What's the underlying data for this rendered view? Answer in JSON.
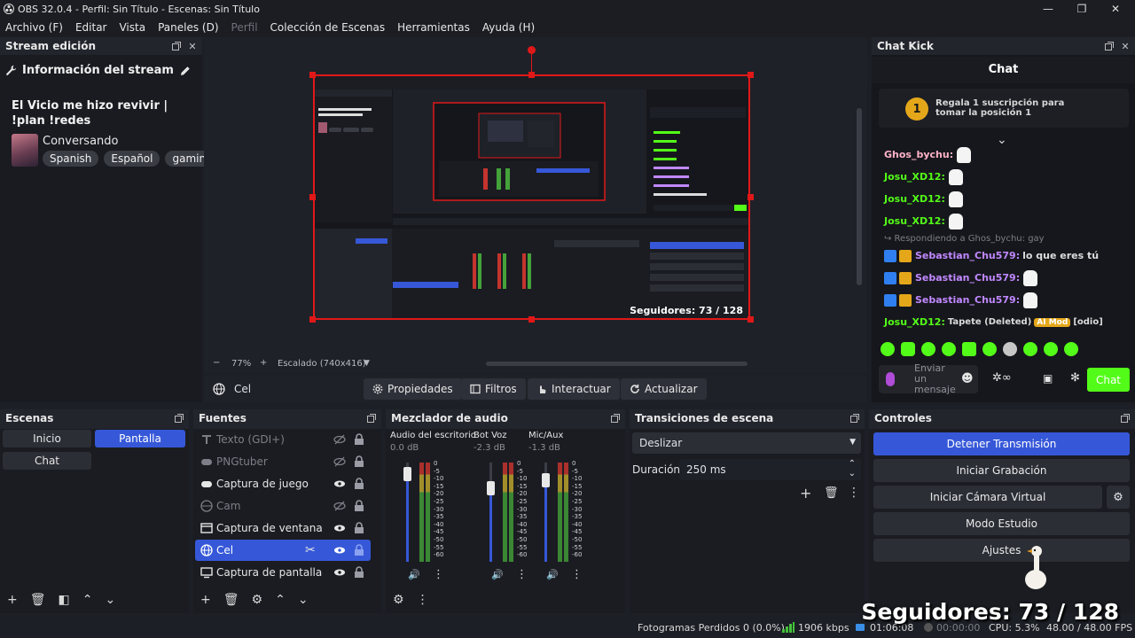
{
  "window": {
    "title": "OBS 32.0.4 - Perfil: Sin Título - Escenas: Sin Título",
    "controls": {
      "minimize": "—",
      "maximize": "❐",
      "close": "✕"
    }
  },
  "menu": [
    {
      "label": "Archivo (F)",
      "disabled": false
    },
    {
      "label": "Editar",
      "disabled": false
    },
    {
      "label": "Vista",
      "disabled": false
    },
    {
      "label": "Paneles (D)",
      "disabled": false
    },
    {
      "label": "Perfil",
      "disabled": true
    },
    {
      "label": "Colección de Escenas",
      "disabled": false
    },
    {
      "label": "Herramientas",
      "disabled": false
    },
    {
      "label": "Ayuda (H)",
      "disabled": false
    }
  ],
  "stream_panel": {
    "header": "Stream edición",
    "info_title": "Información del stream",
    "stream_title": "El Vicio me hizo revivir | !plan !redes",
    "category": "Conversando",
    "tags": [
      "Spanish",
      "Español",
      "gamin"
    ]
  },
  "preview": {
    "overlay_text": "Seguidores: 73 / 128",
    "zoom": "77%",
    "scaling": "Escalado (740x416)"
  },
  "source_toolbar": {
    "selected_source": "Cel",
    "buttons": {
      "properties": "Propiedades",
      "filters": "Filtros",
      "interact": "Interactuar",
      "refresh": "Actualizar"
    }
  },
  "chat": {
    "panel_title": "Chat Kick",
    "header": "Chat",
    "pinned_rank": "1",
    "pinned_text": "Regala 1 suscripción para tomar la posición 1",
    "messages": [
      {
        "user": "Ghos_bychu:",
        "text": "",
        "emote": true,
        "color": "#ffb3c8"
      },
      {
        "user": "Josu_XD12:",
        "text": "",
        "emote": true,
        "color": "#53fc18"
      },
      {
        "user": "Josu_XD12:",
        "text": "",
        "emote": true,
        "color": "#53fc18"
      },
      {
        "user": "Josu_XD12:",
        "text": "",
        "emote": true,
        "color": "#53fc18"
      }
    ],
    "reply_line": "↪ Respondiendo a Ghos_bychu: gay",
    "badge_messages": [
      {
        "user": "Sebastian_Chu579:",
        "text": "lo que eres tú",
        "emote": false
      },
      {
        "user": "Sebastian_Chu579:",
        "text": "",
        "emote": true
      },
      {
        "user": "Sebastian_Chu579:",
        "text": "",
        "emote": true
      }
    ],
    "last_message": {
      "user": "Josu_XD12:",
      "text": "Tapete (Deleted)",
      "mod_badge": "AI Mod",
      "suffix": "[odio]"
    },
    "input_placeholder": "Enviar un mensaje",
    "send_label": "Chat",
    "accent": "#53fc18"
  },
  "scenes": {
    "title": "Escenas",
    "items": [
      {
        "label": "Inicio",
        "active": false
      },
      {
        "label": "Pantalla",
        "active": true
      },
      {
        "label": "Chat",
        "active": false
      }
    ]
  },
  "sources": {
    "title": "Fuentes",
    "items": [
      {
        "label": "Texto (GDI+)",
        "visible": false,
        "icon": "text-icon"
      },
      {
        "label": "PNGtuber",
        "visible": false,
        "icon": "gamepad-icon"
      },
      {
        "label": "Captura de juego",
        "visible": true,
        "icon": "gamepad-icon"
      },
      {
        "label": "Cam",
        "visible": false,
        "icon": "globe-icon"
      },
      {
        "label": "Captura de ventana",
        "visible": true,
        "icon": "window-icon"
      },
      {
        "label": "Cel",
        "visible": true,
        "icon": "globe-icon",
        "selected": true
      },
      {
        "label": "Captura de pantalla",
        "visible": true,
        "icon": "monitor-icon"
      }
    ]
  },
  "mixer": {
    "title": "Mezclador de audio",
    "channels": [
      {
        "name": "Audio del escritorio",
        "db": "0.0 dB",
        "level": 0.88
      },
      {
        "name": "Bot Voz",
        "db": "-2.3 dB",
        "level": 0.74
      },
      {
        "name": "Mic/Aux",
        "db": "-1.3 dB",
        "level": 0.82
      }
    ],
    "scale": [
      "0",
      "-5",
      "-10",
      "-15",
      "-20",
      "-25",
      "-30",
      "-35",
      "-40",
      "-45",
      "-50",
      "-55",
      "-60"
    ]
  },
  "transitions": {
    "title": "Transiciones de escena",
    "selected": "Deslizar",
    "duration_label": "Duración",
    "duration_value": "250 ms"
  },
  "controls": {
    "title": "Controles",
    "stop_stream": "Detener Transmisión",
    "start_record": "Iniciar Grabación",
    "virtual_cam": "Iniciar Cámara Virtual",
    "studio_mode": "Modo Estudio",
    "settings": "Ajustes"
  },
  "status": {
    "dropped": "Fotogramas Perdidos 0 (0.0%)",
    "bitrate": "1906 kbps",
    "stream_time": "01:06:08",
    "rec_time": "00:00:00",
    "cpu": "CPU: 5.3%",
    "fps": "48.00 / 48.00 FPS"
  },
  "overlay_followers": "Seguidores: 73 / 128"
}
